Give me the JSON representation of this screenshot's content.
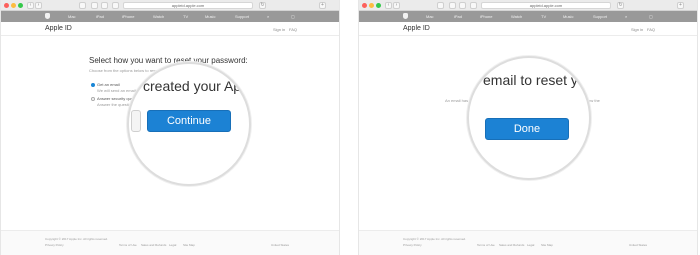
{
  "browser": {
    "url": "appleid.apple.com"
  },
  "nav": {
    "items": [
      "Mac",
      "iPad",
      "iPhone",
      "Watch",
      "TV",
      "Music",
      "Support"
    ]
  },
  "page": {
    "title": "Apple ID",
    "sign_in": "Sign in",
    "faq": "FAQ"
  },
  "left": {
    "heading": "Select how you want to reset your password:",
    "subtext": "Choose from the options below to reset your password.",
    "option_email": "Get an email",
    "option_email_sub": "We will send an email to the address you used when you created your Apple ID.",
    "option_security": "Answer security questions",
    "option_security_sub": "Answer the questions you set up.",
    "magnified_text": "created your Apple ID",
    "continue_button": "Continue"
  },
  "right": {
    "magnified_text": "email to reset y",
    "body_text_left": "An email has been sent",
    "body_text_right": "follow the",
    "done_button": "Done"
  },
  "footer": {
    "copyright": "Copyright © 2017 Apple Inc. All rights reserved.",
    "links": [
      "Privacy Policy",
      "Terms of Use",
      "Sales and Refunds",
      "Legal",
      "Site Map"
    ],
    "region": "United States"
  },
  "colors": {
    "button_blue": "#1c82d4",
    "nav_grey": "#999999"
  }
}
